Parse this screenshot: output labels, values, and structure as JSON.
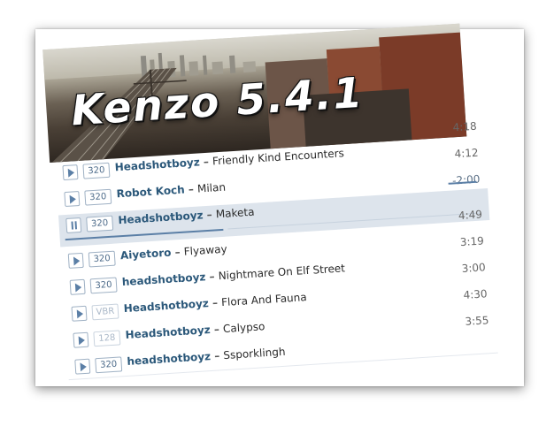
{
  "album": {
    "title": "Kenzo 5.4.1"
  },
  "tracks": [
    {
      "artist": "Headshotboyz",
      "title": "Friendly Kind Encounters",
      "bitrate": "320",
      "duration": "4:18",
      "state": "play"
    },
    {
      "artist": "Robot Koch",
      "title": "Milan",
      "bitrate": "320",
      "duration": "4:12",
      "state": "play"
    },
    {
      "artist": "Headshotboyz",
      "title": "Maketa",
      "bitrate": "320",
      "duration": "-2:00",
      "state": "pause",
      "progress": 0.38
    },
    {
      "artist": "Aiyetoro",
      "title": "Flyaway",
      "bitrate": "320",
      "duration": "4:49",
      "state": "play"
    },
    {
      "artist": "headshotboyz",
      "title": "Nightmare On Elf Street",
      "bitrate": "320",
      "duration": "3:19",
      "state": "play"
    },
    {
      "artist": "Headshotboyz",
      "title": "Flora And Fauna",
      "bitrate": "VBR",
      "duration": "3:00",
      "state": "play"
    },
    {
      "artist": "Headshotboyz",
      "title": "Calypso",
      "bitrate": "128",
      "duration": "4:30",
      "state": "play"
    },
    {
      "artist": "headshotboyz",
      "title": "Ssporklingh",
      "bitrate": "320",
      "duration": "3:55",
      "state": "play"
    }
  ],
  "separator": "–",
  "colors": {
    "accent": "#5b7fa6",
    "artist": "#2b587a",
    "active_row": "#dde4ec"
  }
}
